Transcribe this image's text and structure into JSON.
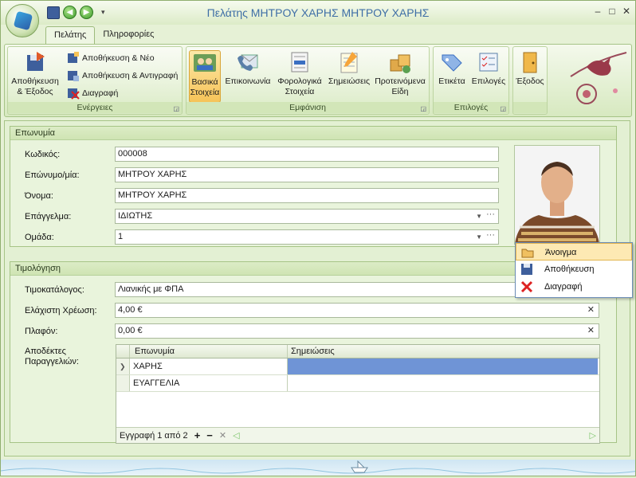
{
  "window": {
    "title": "Πελάτης ΜΗΤΡΟΥ ΧΑΡΗΣ ΜΗΤΡΟΥ ΧΑΡΗΣ"
  },
  "tabs": [
    {
      "label": "Πελάτης"
    },
    {
      "label": "Πληροφορίες"
    }
  ],
  "ribbon": {
    "actions": {
      "label": "Ενέργειες",
      "save_exit": "Αποθήκευση & Έξοδος",
      "save_new": "Αποθήκευση & Νέο",
      "save_copy": "Αποθήκευση & Αντιγραφή",
      "delete": "Διαγραφή"
    },
    "view": {
      "label": "Εμφάνιση",
      "basic": "Βασικά Στοιχεία",
      "contact": "Επικοινωνία",
      "tax": "Φορολογικά Στοιχεία",
      "notes": "Σημειώσεις",
      "preferred": "Προτεινόμενα Είδη"
    },
    "options": {
      "label": "Επιλογές",
      "label_btn": "Ετικέτα",
      "options_btn": "Επιλογές"
    },
    "exit": "Έξοδος"
  },
  "sections": {
    "name": {
      "title": "Επωνυμία",
      "code_label": "Κωδικός:",
      "code": "000008",
      "surname_label": "Επώνυμο/μία:",
      "surname": "ΜΗΤΡΟΥ ΧΑΡΗΣ",
      "firstname_label": "Όνομα:",
      "firstname": "ΜΗΤΡΟΥ ΧΑΡΗΣ",
      "profession_label": "Επάγγελμα:",
      "profession": "ΙΔΙΩΤΗΣ",
      "group_label": "Ομάδα:",
      "group": "1"
    },
    "billing": {
      "title": "Τιμολόγηση",
      "pricelist_label": "Τιμοκατάλογος:",
      "pricelist": "Λιανικής με ΦΠΑ",
      "mincharge_label": "Ελάχιστη Χρέωση:",
      "mincharge": "4,00 €",
      "ceiling_label": "Πλαφόν:",
      "ceiling": "0,00 €",
      "recipients_label": "Αποδέκτες Παραγγελιών:"
    }
  },
  "grid": {
    "columns": [
      "Επωνυμία",
      "Σημειώσεις"
    ],
    "rows": [
      {
        "name": "ΧΑΡΗΣ",
        "notes": ""
      },
      {
        "name": "ΕΥΑΓΓΕΛΙΑ",
        "notes": ""
      }
    ],
    "nav_text": "Εγγραφή 1 από 2"
  },
  "context_menu": {
    "open": "Άνοιγμα",
    "save": "Αποθήκευση",
    "delete": "Διαγραφή"
  },
  "colors": {
    "accent": "#3f6fa6",
    "selected": "#6f94d6",
    "ribbon_selected": "#f6c358"
  }
}
